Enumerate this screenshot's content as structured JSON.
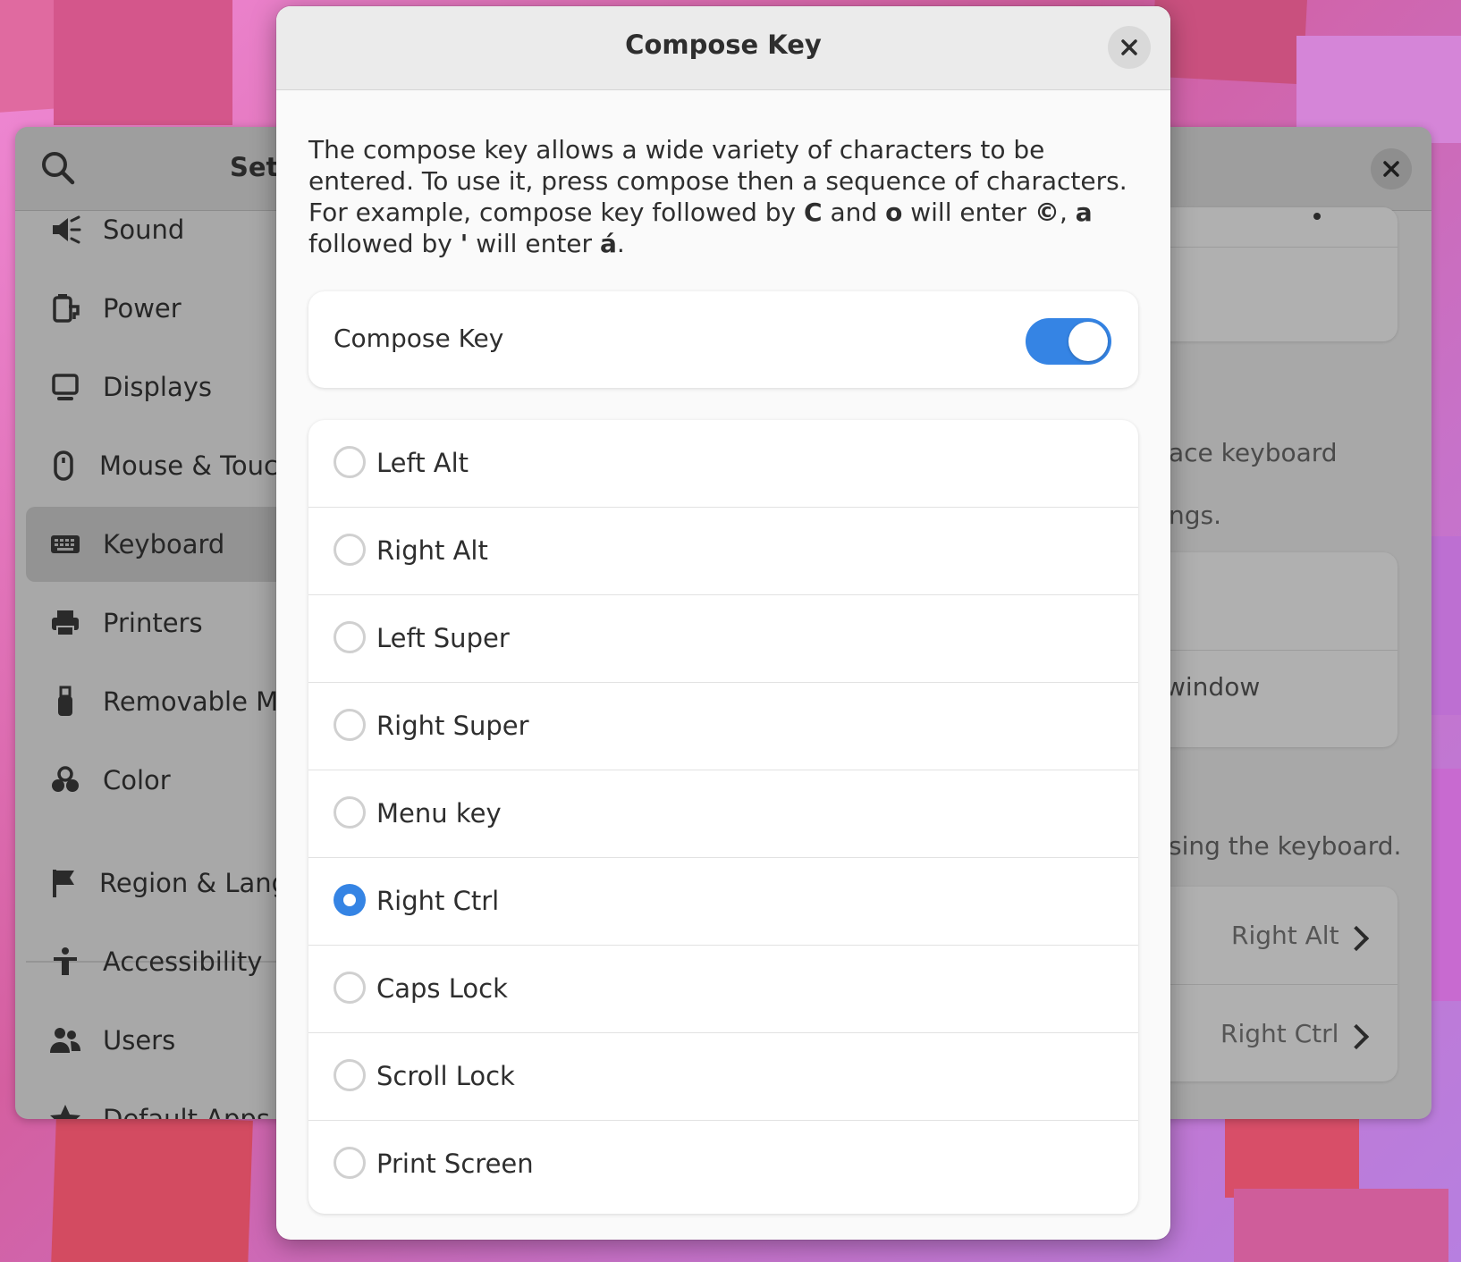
{
  "settings_window": {
    "title": "Sett",
    "sidebar": [
      {
        "label": "Sound",
        "icon": "speaker-icon"
      },
      {
        "label": "Power",
        "icon": "power-icon"
      },
      {
        "label": "Displays",
        "icon": "display-icon"
      },
      {
        "label": "Mouse & Touch",
        "icon": "mouse-icon"
      },
      {
        "label": "Keyboard",
        "icon": "keyboard-icon",
        "selected": true
      },
      {
        "label": "Printers",
        "icon": "printer-icon"
      },
      {
        "label": "Removable Me",
        "icon": "usb-icon"
      },
      {
        "label": "Color",
        "icon": "color-icon"
      },
      {
        "label": "Region & Langu",
        "icon": "flag-icon"
      },
      {
        "label": "Accessibility",
        "icon": "accessibility-icon"
      },
      {
        "label": "Users",
        "icon": "users-icon"
      },
      {
        "label": "Default Apps",
        "icon": "star-icon"
      }
    ],
    "background_content": {
      "text_keyboard": "ace keyboard",
      "text_settings": "ngs.",
      "text_window": "window",
      "text_using": "sing the keyboard.",
      "alternate_chars_value": "Right Alt",
      "compose_key_value": "Right Ctrl"
    }
  },
  "dialog": {
    "title": "Compose Key",
    "description_parts": {
      "p1": "The compose key allows a wide variety of characters to be entered. To use it, press compose then a sequence of characters.  For example, compose key followed by ",
      "k1": "C",
      "p2": " and ",
      "k2": "o",
      "p3": " will enter ",
      "k3": "©",
      "p4": ", ",
      "k4": "a",
      "p5": " followed by ",
      "k5": "'",
      "p6": " will enter ",
      "k6": "á",
      "p7": "."
    },
    "toggle": {
      "label": "Compose Key",
      "on": true
    },
    "options": [
      {
        "label": "Left Alt",
        "selected": false
      },
      {
        "label": "Right Alt",
        "selected": false
      },
      {
        "label": "Left Super",
        "selected": false
      },
      {
        "label": "Right Super",
        "selected": false
      },
      {
        "label": "Menu key",
        "selected": false
      },
      {
        "label": "Right Ctrl",
        "selected": true
      },
      {
        "label": "Caps Lock",
        "selected": false
      },
      {
        "label": "Scroll Lock",
        "selected": false
      },
      {
        "label": "Print Screen",
        "selected": false
      }
    ]
  },
  "colors": {
    "accent": "#3584e4",
    "dialog_bg": "#fafafa",
    "dimmed_window": "#a8a8a8"
  }
}
